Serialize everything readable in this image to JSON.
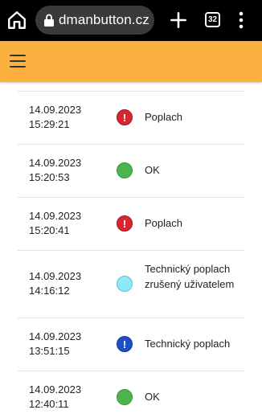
{
  "browser": {
    "url": "dmanbutton.cz",
    "tab_count": "32"
  },
  "colors": {
    "header": "#fbb040",
    "alarm": "#d8262f",
    "ok": "#4db34d",
    "cancelled": "#8ee9f7",
    "technical": "#1f4ec9"
  },
  "events": [
    {
      "date": "14.09.2023",
      "time": "15:29:21",
      "icon": "alarm-icon",
      "icon_glyph": "!",
      "label": "Poplach"
    },
    {
      "date": "14.09.2023",
      "time": "15:20:53",
      "icon": "ok-icon",
      "icon_glyph": "",
      "label": "OK"
    },
    {
      "date": "14.09.2023",
      "time": "15:20:41",
      "icon": "alarm-icon",
      "icon_glyph": "!",
      "label": "Poplach"
    },
    {
      "date": "14.09.2023",
      "time": "14:16:12",
      "icon": "cancelled-icon",
      "icon_glyph": "",
      "label": "Technický poplach zrušený uživatelem"
    },
    {
      "date": "14.09.2023",
      "time": "13:51:15",
      "icon": "technical-alarm-icon",
      "icon_glyph": "!",
      "label": "Technický poplach"
    },
    {
      "date": "14.09.2023",
      "time": "12:40:11",
      "icon": "ok-icon",
      "icon_glyph": "",
      "label": "OK"
    }
  ]
}
